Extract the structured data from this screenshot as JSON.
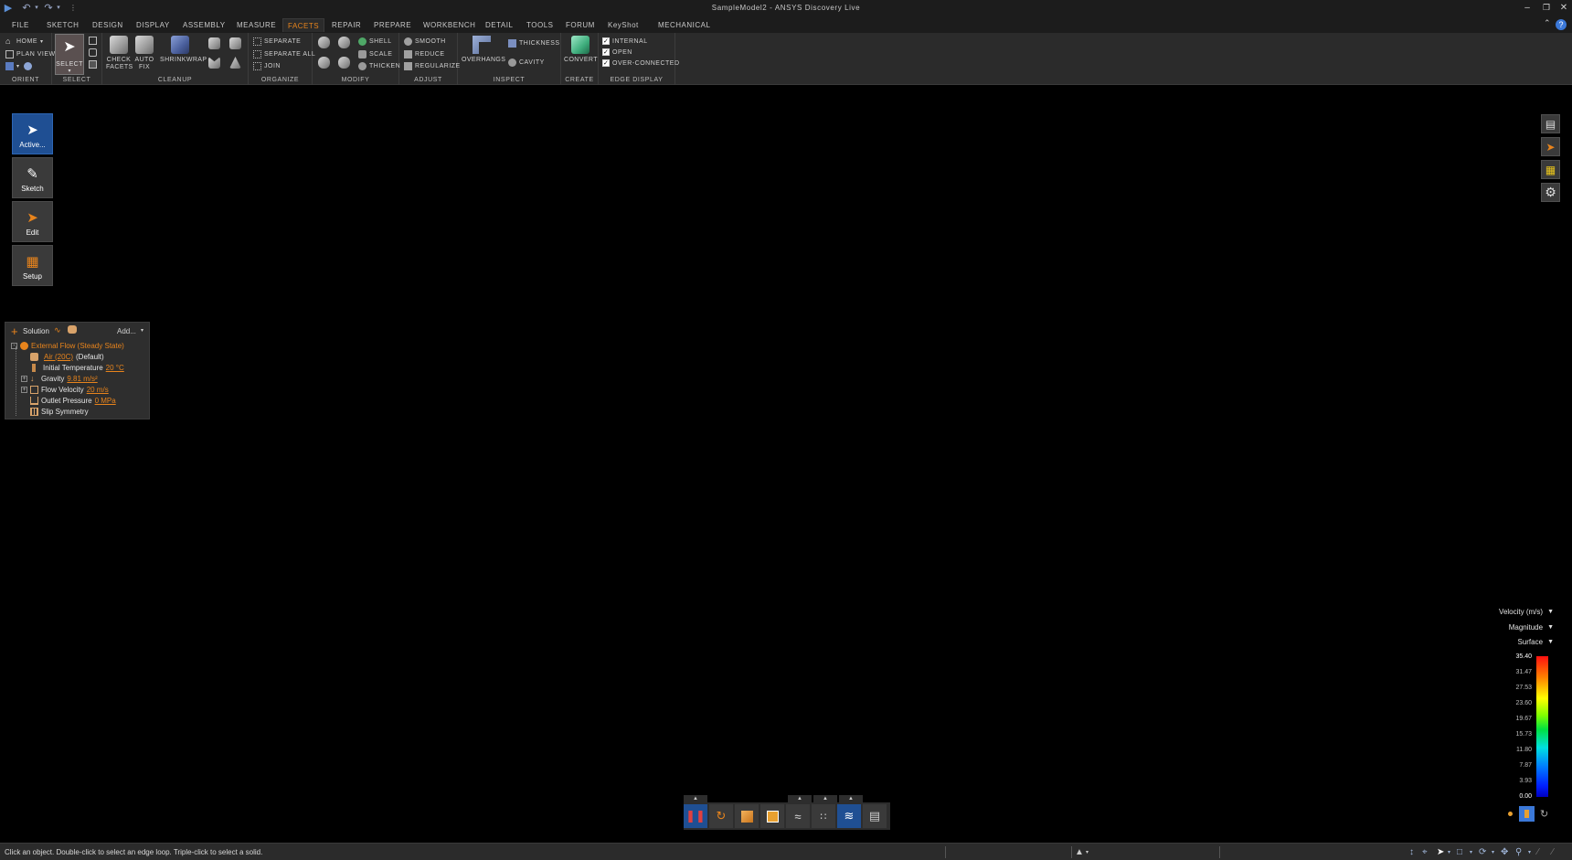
{
  "app": {
    "window_title": "SampleModel2 - ANSYS Discovery Live"
  },
  "menu": {
    "tabs": [
      "File",
      "Sketch",
      "Design",
      "Display",
      "Assembly",
      "Measure",
      "Facets",
      "Repair",
      "Prepare",
      "Workbench",
      "Detail",
      "Tools",
      "Forum",
      "KeyShot",
      "Mechanical"
    ],
    "active_tab": "Facets",
    "help": "?"
  },
  "ribbon": {
    "orient": {
      "label": "Orient",
      "home": "Home",
      "plan_view": "Plan View"
    },
    "select": {
      "label": "Select",
      "select_button": "Select"
    },
    "cleanup": {
      "label": "Cleanup",
      "check_facets": "Check Facets",
      "auto_fix": "Auto Fix",
      "shrinkwrap": "Shrinkwrap"
    },
    "organize": {
      "label": "Organize",
      "separate": "Separate",
      "separate_all": "Separate All",
      "join": "Join"
    },
    "modify": {
      "label": "Modify",
      "shell": "Shell",
      "scale": "Scale",
      "thicken": "Thicken"
    },
    "adjust": {
      "label": "Adjust",
      "smooth": "Smooth",
      "reduce": "Reduce",
      "regularize": "Regularize"
    },
    "inspect": {
      "label": "Inspect",
      "overhangs": "Overhangs",
      "thickness": "Thickness",
      "cavity": "Cavity"
    },
    "create": {
      "label": "Create",
      "convert": "Convert"
    },
    "edge_display": {
      "label": "Edge Display",
      "internal": "Internal",
      "open": "Open",
      "over_connected": "Over-Connected"
    }
  },
  "left_toolbar": {
    "active": "Active...",
    "sketch": "Sketch",
    "edit": "Edit",
    "setup": "Setup"
  },
  "solution_panel": {
    "title": "Solution",
    "add": "Add...",
    "root": "External Flow (Steady State)",
    "items": [
      {
        "label": "",
        "value": "Air (20C)",
        "suffix": "(Default)"
      },
      {
        "label": "Initial Temperature",
        "value": "20 °C"
      },
      {
        "label": "Gravity",
        "value": "9.81 m/s²"
      },
      {
        "label": "Flow Velocity",
        "value": "20 m/s"
      },
      {
        "label": "Outlet Pressure",
        "value": "0 MPa"
      },
      {
        "label": "Slip Symmetry",
        "value": ""
      }
    ]
  },
  "legend": {
    "quantity": "Velocity (m/s)",
    "component": "Magnitude",
    "display": "Surface",
    "ticks": [
      "35.40",
      "31.47",
      "27.53",
      "23.60",
      "19.67",
      "15.73",
      "11.80",
      "7.87",
      "3.93",
      "0.00"
    ]
  },
  "statusbar": {
    "message": "Click an object. Double-click to select an edge loop. Triple-click to select a solid."
  },
  "colors": {
    "accent": "#e8841c",
    "active_blue": "#1f4f93",
    "background": "#000000"
  }
}
